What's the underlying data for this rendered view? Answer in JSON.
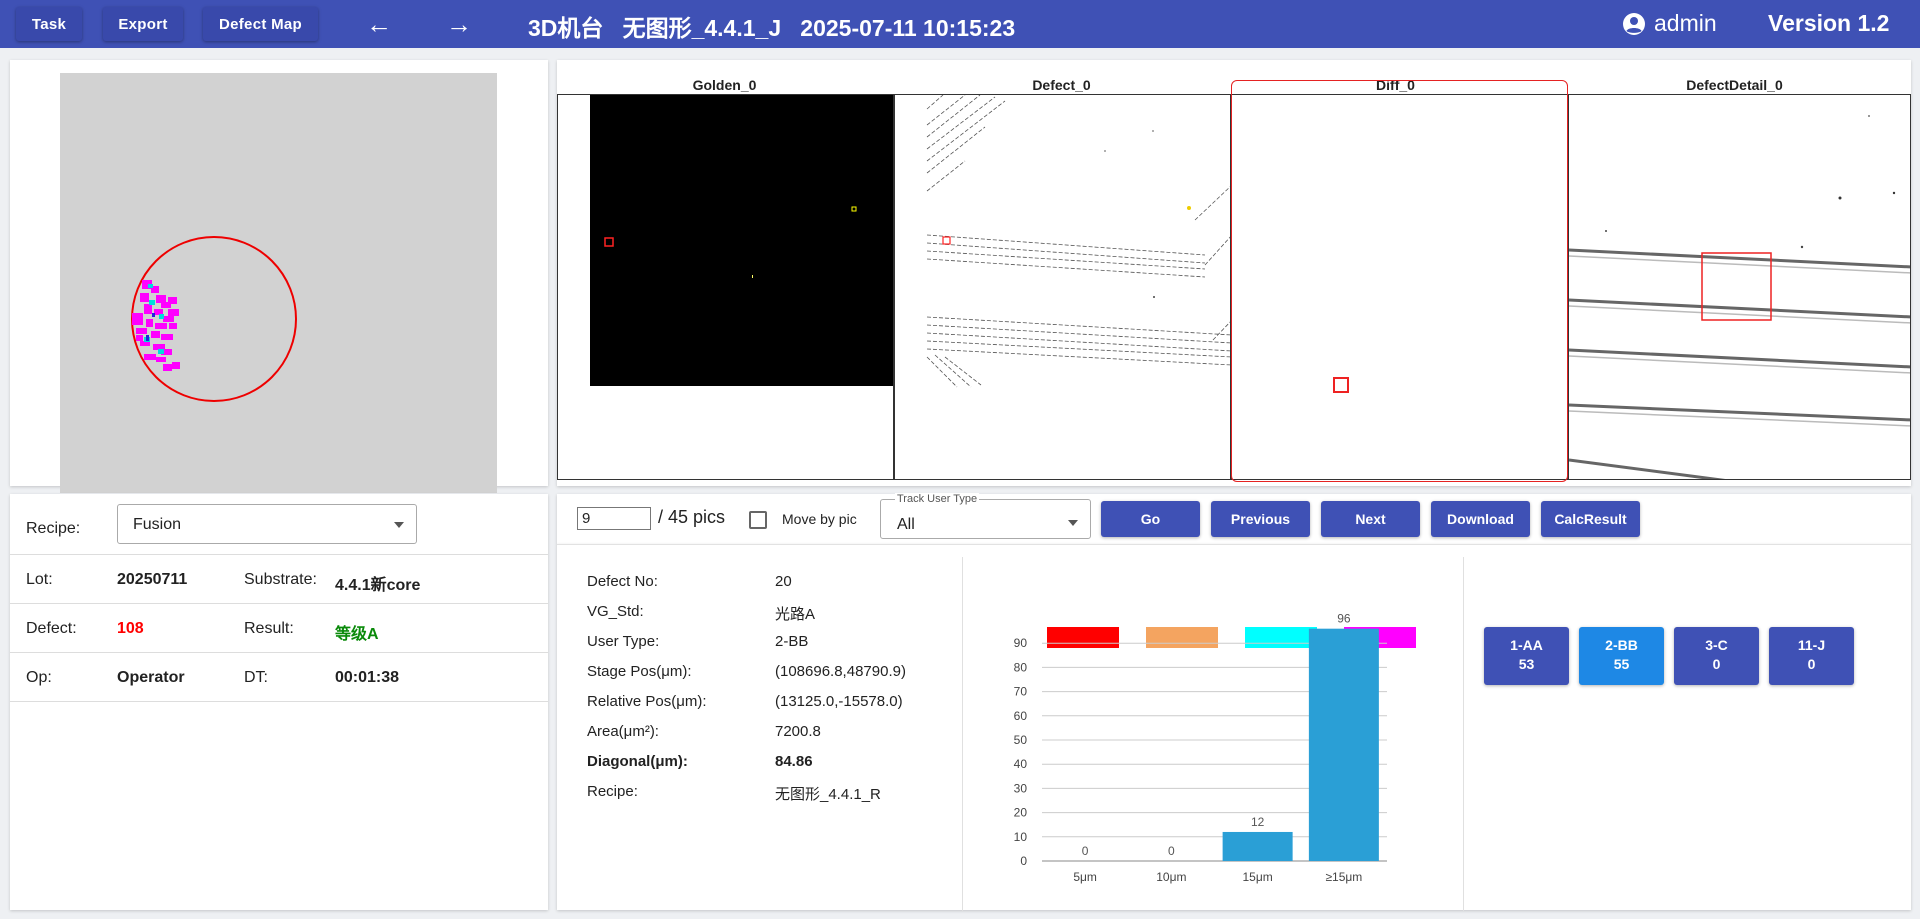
{
  "topbar": {
    "task_label": "Task",
    "export_label": "Export",
    "defect_map_label": "Defect Map",
    "machine": "3D机台",
    "recipe_name": "无图形_4.4.1_J",
    "datetime": "2025-07-11 10:15:23",
    "user": "admin",
    "version": "Version 1.2",
    "colors": {
      "bar": "#3f51b5",
      "button": "#3949ab"
    }
  },
  "summary": {
    "recipe_label": "Recipe:",
    "recipe_value": "Fusion",
    "lot_label": "Lot:",
    "lot_value": "20250711",
    "substrate_label": "Substrate:",
    "substrate_value": "4.4.1新core",
    "defect_label": "Defect:",
    "defect_value": "108",
    "result_label": "Result:",
    "result_value": "等级A",
    "op_label": "Op:",
    "op_value": "Operator",
    "dt_label": "DT:",
    "dt_value": "00:01:38",
    "colors": {
      "defect": "#ff0000",
      "result": "#0a8a0a"
    }
  },
  "images": {
    "golden_title": "Golden_0",
    "defect_title": "Defect_0",
    "diff_title": "Diff_0",
    "detail_title": "DefectDetail_0"
  },
  "nav": {
    "current_pic": "9",
    "total_pics": "/ 45 pics",
    "move_by_pic_label": "Move by pic",
    "track_label": "Track User Type",
    "track_value": "All",
    "go_label": "Go",
    "previous_label": "Previous",
    "next_label": "Next",
    "download_label": "Download",
    "calc_label": "CalcResult"
  },
  "defect_info": [
    {
      "label": "Defect No:",
      "value": "20",
      "bold": false
    },
    {
      "label": "VG_Std:",
      "value": "光路A",
      "bold": false
    },
    {
      "label": "User Type:",
      "value": "2-BB",
      "bold": false
    },
    {
      "label": "Stage Pos(μm):",
      "value": "(108696.8,48790.9)",
      "bold": false
    },
    {
      "label": "Relative Pos(μm):",
      "value": "(13125.0,-15578.0)",
      "bold": false
    },
    {
      "label": "Area(μm²):",
      "value": "7200.8",
      "bold": false
    },
    {
      "label": "Diagonal(μm):",
      "value": "84.86",
      "bold": true
    },
    {
      "label": "Recipe:",
      "value": "无图形_4.4.1_R",
      "bold": false
    }
  ],
  "legend_colors": [
    "#ff0000",
    "#f4a460",
    "#00ffff",
    "#ff00ff"
  ],
  "chart_data": {
    "type": "bar",
    "categories": [
      "5μm",
      "10μm",
      "15μm",
      "≥15μm"
    ],
    "values": [
      0,
      0,
      12,
      96
    ],
    "yticks": [
      "0",
      "10",
      "20",
      "30",
      "40",
      "50",
      "60",
      "70",
      "80",
      "90"
    ],
    "ylim": [
      0,
      96
    ],
    "bar_color": "#2a9fd6",
    "grid": true
  },
  "user_types": [
    {
      "name": "1-AA",
      "count": "53",
      "active": false
    },
    {
      "name": "2-BB",
      "count": "55",
      "active": true
    },
    {
      "name": "3-C",
      "count": "0",
      "active": false
    },
    {
      "name": "11-J",
      "count": "0",
      "active": false
    }
  ],
  "user_type_colors": {
    "normal": "#3f51b5",
    "active": "#1e88e5"
  }
}
